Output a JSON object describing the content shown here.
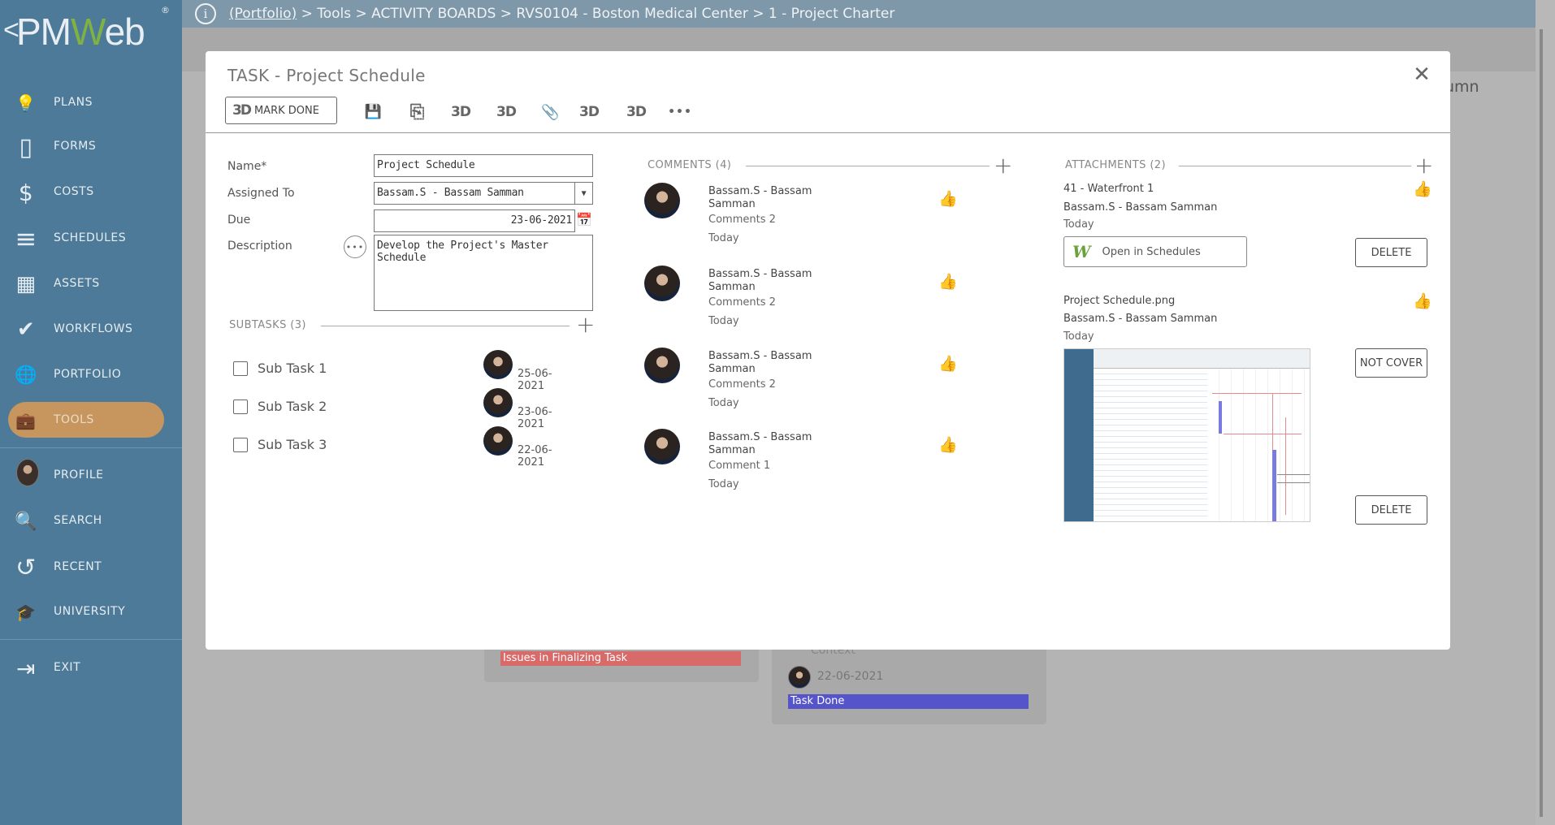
{
  "logo": {
    "chevron": "<",
    "text_a": "PM",
    "text_b": "W",
    "text_c": "eb",
    "reg": "®"
  },
  "sidebar": {
    "items": [
      {
        "label": "PLANS",
        "icon": "lightbulb-icon",
        "glyph": "💡"
      },
      {
        "label": "FORMS",
        "icon": "document-icon",
        "glyph": "▯"
      },
      {
        "label": "COSTS",
        "icon": "dollar-icon",
        "glyph": "$"
      },
      {
        "label": "SCHEDULES",
        "icon": "schedule-bars-icon",
        "glyph": "≡"
      },
      {
        "label": "ASSETS",
        "icon": "building-icon",
        "glyph": "▦"
      },
      {
        "label": "WORKFLOWS",
        "icon": "checkmark-icon",
        "glyph": "✔"
      },
      {
        "label": "PORTFOLIO",
        "icon": "globe-icon",
        "glyph": "🌐"
      },
      {
        "label": "TOOLS",
        "icon": "briefcase-icon",
        "glyph": "💼",
        "active": true
      },
      {
        "label": "PROFILE",
        "icon": "avatar",
        "glyph": ""
      },
      {
        "label": "SEARCH",
        "icon": "search-icon",
        "glyph": "🔍"
      },
      {
        "label": "RECENT",
        "icon": "history-icon",
        "glyph": "↺"
      },
      {
        "label": "UNIVERSITY",
        "icon": "graduation-cap-icon",
        "glyph": "🎓"
      },
      {
        "label": "EXIT",
        "icon": "exit-icon",
        "glyph": "⇥"
      }
    ]
  },
  "topbar": {
    "info_glyph": "i",
    "crumb_link": "(Portfolio)",
    "crumb_rest": " > Tools > ACTIVITY BOARDS > RVS0104 - Boston Medical Center > 1 - Project Charter"
  },
  "background": {
    "column_text": "umn",
    "context": "Context",
    "card_date": "22-06-2021",
    "red_label": "Issues in Finalizing Task",
    "blue_label": "Task Done"
  },
  "modal": {
    "title": "TASK - Project Schedule",
    "close_glyph": "✕",
    "mark_done_icon": "3D",
    "mark_done_label": "MARK DONE",
    "toolbar": [
      {
        "icon": "save-icon",
        "glyph": "💾"
      },
      {
        "icon": "export-icon",
        "glyph": "⎘"
      },
      {
        "icon": "3d-icon",
        "glyph": "3D"
      },
      {
        "icon": "3d-icon",
        "glyph": "3D"
      },
      {
        "icon": "paperclip-icon",
        "glyph": "📎"
      },
      {
        "icon": "3d-icon",
        "glyph": "3D"
      },
      {
        "icon": "3d-icon",
        "glyph": "3D"
      },
      {
        "icon": "more-icon",
        "glyph": "•••"
      }
    ],
    "form": {
      "name_label": "Name*",
      "name_value": "Project Schedule",
      "assigned_label": "Assigned To",
      "assigned_value": "Bassam.S - Bassam Samman",
      "due_label": "Due",
      "due_value": "23-06-2021",
      "description_label": "Description",
      "description_value": "Develop the Project's Master Schedule"
    },
    "subtasks": {
      "header": "SUBTASKS (3)",
      "items": [
        {
          "label": "Sub Task 1",
          "date": "25-06-2021"
        },
        {
          "label": "Sub Task 2",
          "date": "23-06-2021"
        },
        {
          "label": "Sub Task 3",
          "date": "22-06-2021"
        }
      ]
    },
    "comments": {
      "header": "COMMENTS (4)",
      "items": [
        {
          "name": "Bassam.S - Bassam Samman",
          "body": "Comments 2",
          "when": "Today"
        },
        {
          "name": "Bassam.S - Bassam Samman",
          "body": "Comments 2",
          "when": "Today"
        },
        {
          "name": "Bassam.S - Bassam Samman",
          "body": "Comments 2",
          "when": "Today"
        },
        {
          "name": "Bassam.S - Bassam Samman",
          "body": "Comment 1",
          "when": "Today"
        }
      ]
    },
    "attachments": {
      "header": "ATTACHMENTS (2)",
      "items": [
        {
          "title": "41 - Waterfront 1",
          "user": "Bassam.S - Bassam Samman",
          "when": "Today",
          "open_label": "Open in Schedules",
          "open_icon": "W",
          "action": "DELETE"
        },
        {
          "title": "Project Schedule.png",
          "user": "Bassam.S - Bassam Samman",
          "when": "Today",
          "cover_action": "NOT COVER",
          "action": "DELETE"
        }
      ]
    },
    "plus_glyph": "+",
    "like_glyph": "👍"
  },
  "colors": {
    "sidebar": "#4d7a98",
    "active_pill": "#c7965f",
    "red_bar": "#d86a6a",
    "blue_bar": "#5554c9"
  }
}
